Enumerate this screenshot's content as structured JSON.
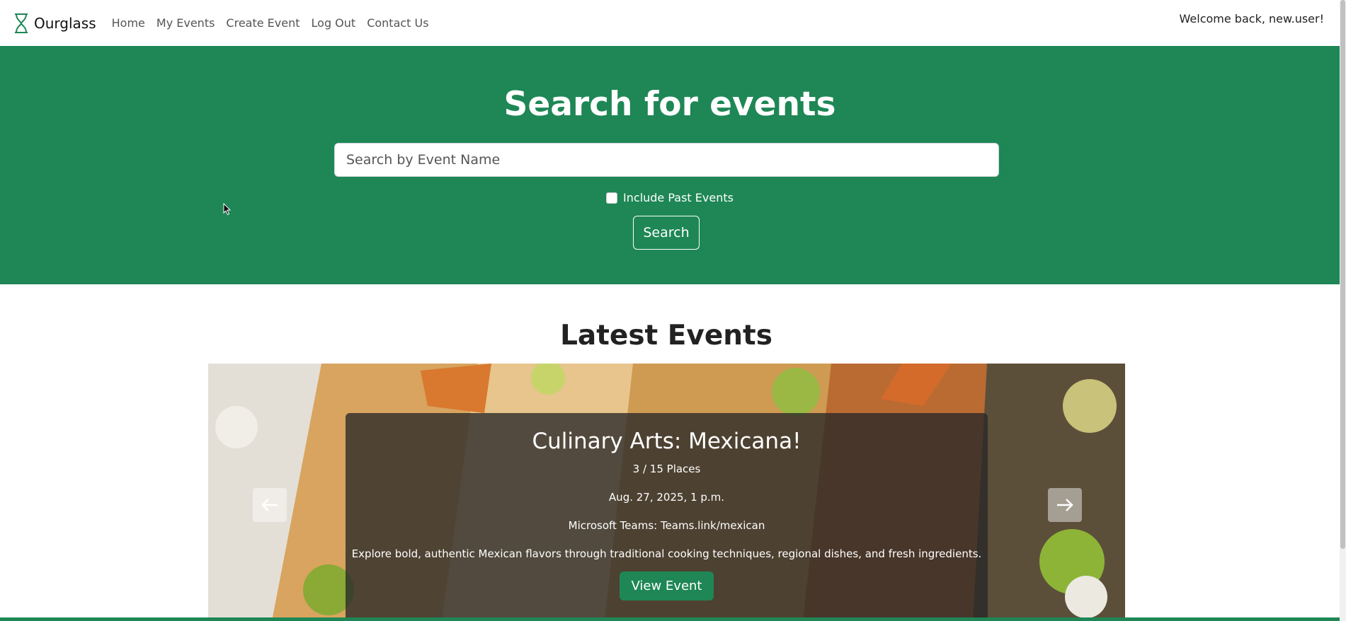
{
  "nav": {
    "brand": "Ourglass",
    "links": [
      "Home",
      "My Events",
      "Create Event",
      "Log Out",
      "Contact Us"
    ],
    "welcome": "Welcome back, new.user!"
  },
  "hero": {
    "title": "Search for events",
    "search_placeholder": "Search by Event Name",
    "checkbox_label": "Include Past Events",
    "search_button": "Search"
  },
  "latest": {
    "title": "Latest Events",
    "event": {
      "title": "Culinary Arts: Mexicana!",
      "places": "3 / 15 Places",
      "date": "Aug. 27, 2025, 1 p.m.",
      "location": "Microsoft Teams: Teams.link/mexican",
      "description": "Explore bold, authentic Mexican flavors through traditional cooking techniques, regional dishes, and fresh ingredients.",
      "button": "View Event"
    }
  },
  "colors": {
    "brand_green": "#1e8755",
    "caption_bg": "rgba(40,40,40,0.78)"
  },
  "icons": [
    "hourglass-icon",
    "arrow-left-icon",
    "arrow-right-icon",
    "cursor-icon"
  ]
}
